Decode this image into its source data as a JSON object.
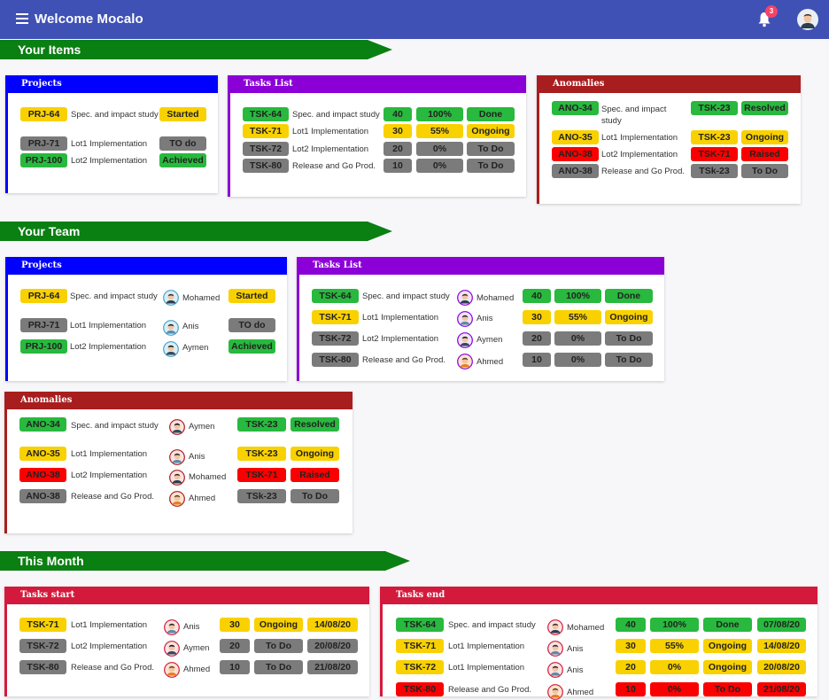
{
  "header": {
    "title": "Welcome Mocalo",
    "notifications": "3"
  },
  "sections": {
    "items": "Your Items",
    "team": "Your Team",
    "month": "This Month"
  },
  "colors": {
    "topbar": "#3f51b5",
    "banner": "#0a7f12",
    "blue": "#0000ff",
    "purple": "#8b00d6",
    "brown": "#a81e1e",
    "crimson": "#d41a3c",
    "green": "#28b93e",
    "yellow": "#f9d100",
    "grey": "#7b7b7b",
    "red": "#fb0000"
  },
  "items": {
    "projects": {
      "title": "Projects",
      "rows": [
        {
          "id": "PRJ-64",
          "name": "Spec. and impact study",
          "status": "Started"
        },
        {
          "id": "PRJ-71",
          "name": "Lot1 Implementation",
          "status": "TO do"
        },
        {
          "id": "PRJ-100",
          "name": "Lot2 Implementation",
          "status": "Achieved"
        }
      ]
    },
    "tasks": {
      "title": "Tasks List",
      "rows": [
        {
          "id": "TSK-64",
          "name": "Spec. and impact study",
          "qty": "40",
          "pct": "100%",
          "status": "Done"
        },
        {
          "id": "TSK-71",
          "name": "Lot1 Implementation",
          "qty": "30",
          "pct": "55%",
          "status": "Ongoing"
        },
        {
          "id": "TSK-72",
          "name": "Lot2 Implementation",
          "qty": "20",
          "pct": "0%",
          "status": "To Do"
        },
        {
          "id": "TSK-80",
          "name": "Release and Go Prod.",
          "qty": "10",
          "pct": "0%",
          "status": "To Do"
        }
      ]
    },
    "anomalies": {
      "title": "Anomalies",
      "rows": [
        {
          "id": "ANO-34",
          "name": "Spec. and impact study",
          "task": "TSK-23",
          "status": "Resolved"
        },
        {
          "id": "ANO-35",
          "name": "Lot1 Implementation",
          "task": "TSK-23",
          "status": "Ongoing"
        },
        {
          "id": "ANO-38",
          "name": "Lot2 Implementation",
          "task": "TSK-71",
          "status": "Raised"
        },
        {
          "id": "ANO-38",
          "name": "Release and Go Prod.",
          "task": "TSk-23",
          "status": "To Do"
        }
      ]
    }
  },
  "team": {
    "projects": {
      "title": "Projects",
      "rows": [
        {
          "id": "PRJ-64",
          "name": "Spec. and impact study",
          "person": "Mohamed",
          "status": "Started"
        },
        {
          "id": "PRJ-71",
          "name": "Lot1 Implementation",
          "person": "Anis",
          "status": "TO do"
        },
        {
          "id": "PRJ-100",
          "name": "Lot2 Implementation",
          "person": "Aymen",
          "status": "Achieved"
        }
      ]
    },
    "tasks": {
      "title": "Tasks List",
      "rows": [
        {
          "id": "TSK-64",
          "name": "Spec. and impact study",
          "person": "Mohamed",
          "qty": "40",
          "pct": "100%",
          "status": "Done"
        },
        {
          "id": "TSK-71",
          "name": "Lot1 Implementation",
          "person": "Anis",
          "qty": "30",
          "pct": "55%",
          "status": "Ongoing"
        },
        {
          "id": "TSK-72",
          "name": "Lot2 Implementation",
          "person": "Aymen",
          "qty": "20",
          "pct": "0%",
          "status": "To Do"
        },
        {
          "id": "TSK-80",
          "name": "Release and Go Prod.",
          "person": "Ahmed",
          "qty": "10",
          "pct": "0%",
          "status": "To Do"
        }
      ]
    },
    "anomalies": {
      "title": "Anomalies",
      "rows": [
        {
          "id": "ANO-34",
          "name": "Spec. and impact study",
          "person": "Aymen",
          "task": "TSK-23",
          "status": "Resolved"
        },
        {
          "id": "ANO-35",
          "name": "Lot1 Implementation",
          "person": "Anis",
          "task": "TSK-23",
          "status": "Ongoing"
        },
        {
          "id": "ANO-38",
          "name": "Lot2 Implementation",
          "person": "Mohamed",
          "task": "TSK-71",
          "status": "Raised"
        },
        {
          "id": "ANO-38",
          "name": "Release and Go Prod.",
          "person": "Ahmed",
          "task": "TSk-23",
          "status": "To Do"
        }
      ]
    }
  },
  "month": {
    "start": {
      "title": "Tasks start",
      "rows": [
        {
          "id": "TSK-71",
          "name": "Lot1 Implementation",
          "person": "Anis",
          "qty": "30",
          "status": "Ongoing",
          "date": "14/08/20"
        },
        {
          "id": "TSK-72",
          "name": "Lot2 Implementation",
          "person": "Aymen",
          "qty": "20",
          "status": "To Do",
          "date": "20/08/20"
        },
        {
          "id": "TSK-80",
          "name": "Release and Go Prod.",
          "person": "Ahmed",
          "qty": "10",
          "status": "To Do",
          "date": "21/08/20"
        }
      ]
    },
    "end": {
      "title": "Tasks end",
      "rows": [
        {
          "id": "TSK-64",
          "name": "Spec. and impact study",
          "person": "Mohamed",
          "qty": "40",
          "pct": "100%",
          "status": "Done",
          "date": "07/08/20"
        },
        {
          "id": "TSK-71",
          "name": "Lot1 Implementation",
          "person": "Anis",
          "qty": "30",
          "pct": "55%",
          "status": "Ongoing",
          "date": "14/08/20"
        },
        {
          "id": "TSK-72",
          "name": "Lot1 Implementation",
          "person": "Anis",
          "qty": "20",
          "pct": "0%",
          "status": "Ongoing",
          "date": "20/08/20"
        },
        {
          "id": "TSK-80",
          "name": "Release and Go Prod.",
          "person": "Ahmed",
          "qty": "10",
          "pct": "0%",
          "status": "To Do",
          "date": "21/08/20"
        }
      ]
    }
  }
}
